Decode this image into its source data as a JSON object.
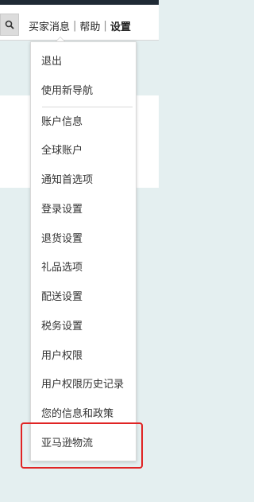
{
  "nav": {
    "links": [
      "买家消息",
      "帮助",
      "设置"
    ],
    "separator": "|"
  },
  "menu": {
    "items": [
      "退出",
      "使用新导航",
      "账户信息",
      "全球账户",
      "通知首选项",
      "登录设置",
      "退货设置",
      "礼品选项",
      "配送设置",
      "税务设置",
      "用户权限",
      "用户权限历史记录",
      "您的信息和政策",
      "亚马逊物流"
    ],
    "highlighted": "亚马逊物流"
  },
  "colors": {
    "highlight_frame": "#e02424",
    "background": "#e4eff0"
  }
}
